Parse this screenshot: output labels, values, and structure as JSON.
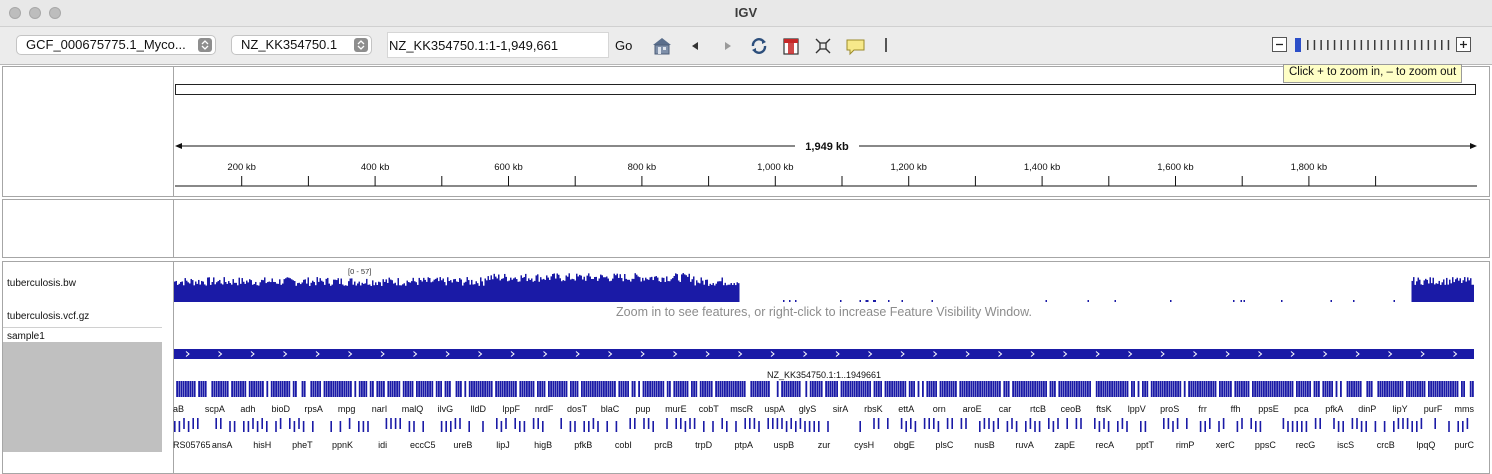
{
  "window": {
    "title": "IGV",
    "colors": {
      "titlebar": "#e8e8e8",
      "toolbar": "#ececec",
      "track_blue": "#1a1aa6",
      "tooltip_bg": "#fefec6"
    }
  },
  "toolbar": {
    "genome_select": "GCF_000675775.1_Myco...",
    "chromosome_select": "NZ_KK354750.1",
    "locus_value": "NZ_KK354750.1:1-1,949,661",
    "go_label": "Go",
    "icons": [
      "home-icon",
      "back-icon",
      "forward-icon",
      "refresh-icon",
      "region-of-interest-icon",
      "resize-to-window-icon",
      "popup-info-icon",
      "ruler-divider-icon"
    ],
    "zoom_tooltip": "Click + to zoom in,  – to zoom out",
    "zoom_level": 0
  },
  "ruler": {
    "span_label": "1,949 kb",
    "ticks": [
      "200 kb",
      "400 kb",
      "600 kb",
      "800 kb",
      "1,000 kb",
      "1,200 kb",
      "1,400 kb",
      "1,600 kb",
      "1,800 kb"
    ]
  },
  "tracks": {
    "bigwig": {
      "name": "tuberculosis.bw",
      "range_label": "[0 - 57]"
    },
    "vcf": {
      "name": "tuberculosis.vcf.gz",
      "message": "Zoom in to see features, or right-click to increase Feature Visibility Window."
    },
    "sample": {
      "name": "sample1"
    },
    "annotation": {
      "contig_label": "NZ_KK354750.1:1..1949661",
      "genes_top": [
        "aB",
        "scpA",
        "adh",
        "bioD",
        "rpsA",
        "mpg",
        "narI",
        "malQ",
        "ilvG",
        "lldD",
        "lppF",
        "nrdF",
        "dosT",
        "blaC",
        "pup",
        "murE",
        "cobT",
        "mscR",
        "uspA",
        "glyS",
        "sirA",
        "rbsK",
        "ettA",
        "orn",
        "aroE",
        "car",
        "rtcB",
        "ceoB",
        "ftsK",
        "lppV",
        "proS",
        "frr",
        "ffh",
        "ppsE",
        "pca",
        "pfkA",
        "dinP",
        "lipY",
        "purF",
        "mms"
      ],
      "genes_bottom": [
        "RS05765",
        "ansA",
        "hisH",
        "pheT",
        "ppnK",
        "idi",
        "eccC5",
        "ureB",
        "lipJ",
        "higB",
        "pfkB",
        "cobI",
        "prcB",
        "trpD",
        "ptpA",
        "uspB",
        "zur",
        "cysH",
        "obgE",
        "plsC",
        "nusB",
        "ruvA",
        "zapE",
        "recA",
        "pptT",
        "rimP",
        "xerC",
        "ppsC",
        "recG",
        "iscS",
        "crcB",
        "lpqQ",
        "purC"
      ]
    }
  }
}
